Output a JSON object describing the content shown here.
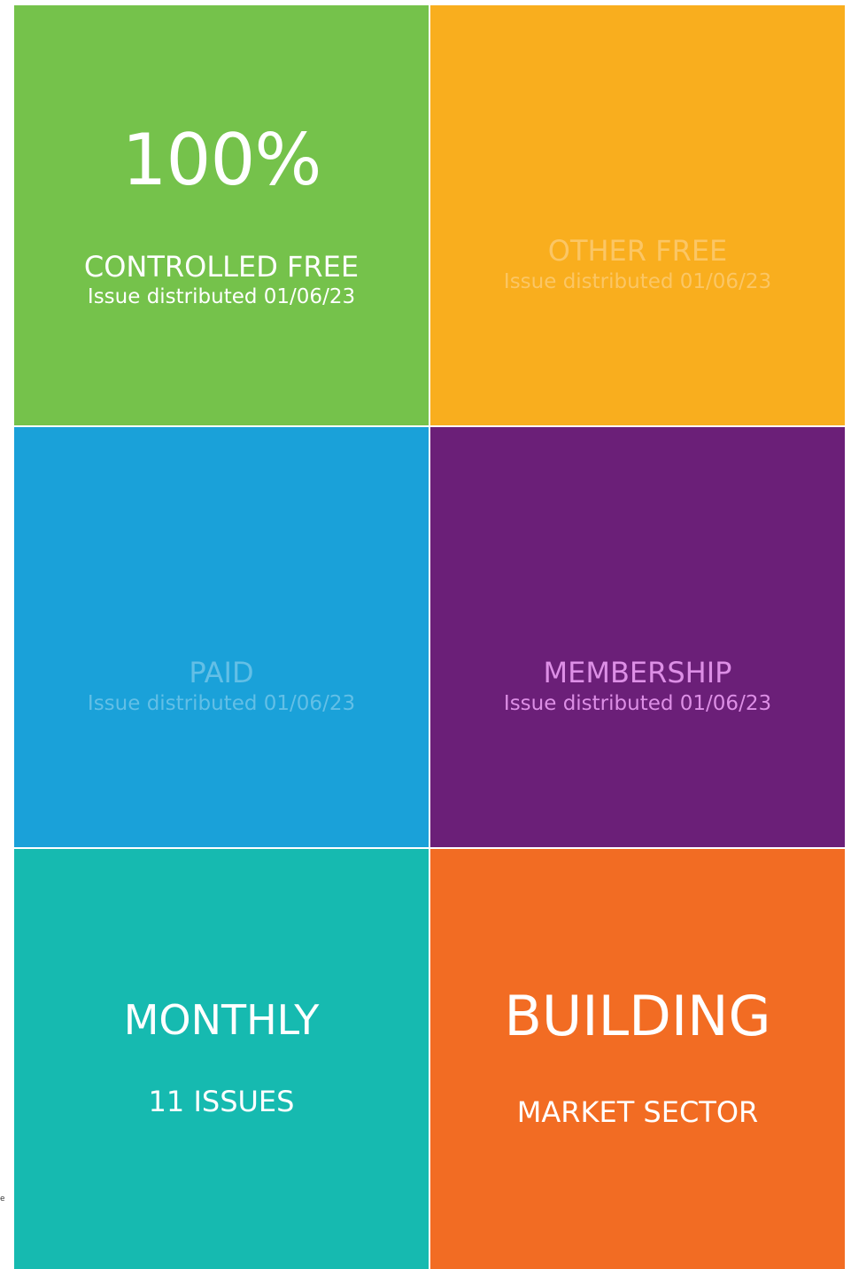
{
  "tiles": {
    "controlled_free": {
      "percent": "100%",
      "title": "CONTROLLED FREE",
      "subtitle": "Issue distributed 01/06/23",
      "bg": "#75c24b",
      "text_color": "#ffffff"
    },
    "other_free": {
      "title": "OTHER FREE",
      "subtitle": "Issue distributed 01/06/23",
      "bg": "#f9ae1e",
      "text_color": "#fbc665"
    },
    "paid": {
      "title": "PAID",
      "subtitle": "Issue distributed 01/06/23",
      "bg": "#1aa1d9",
      "text_color": "#63bfe6"
    },
    "membership": {
      "title": "MEMBERSHIP",
      "subtitle": "Issue distributed 01/06/23",
      "bg": "#6b1f78",
      "text_color": "#dd8fe6"
    },
    "frequency": {
      "title": "MONTHLY",
      "subtitle": "11 ISSUES",
      "bg": "#16bab0",
      "text_color": "#ffffff"
    },
    "sector": {
      "title": "BUILDING",
      "subtitle": "MARKET SECTOR",
      "bg": "#f26c23",
      "text_color": "#ffffff"
    }
  },
  "side_mark": "e"
}
